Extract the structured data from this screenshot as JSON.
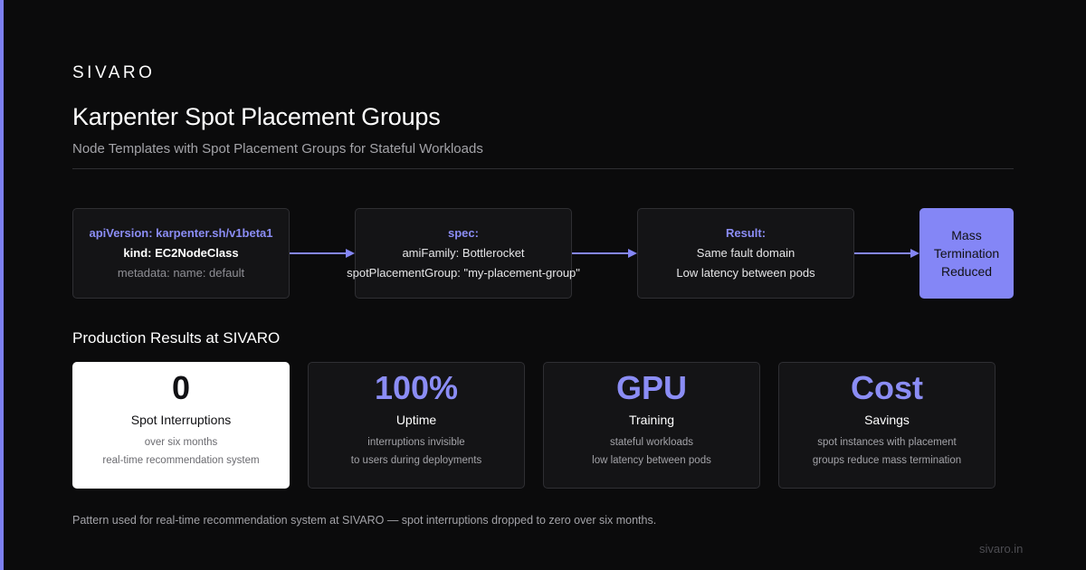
{
  "brand": "SIVARO",
  "title": "Karpenter Spot Placement Groups",
  "subtitle": "Node Templates with Spot Placement Groups for Stateful Workloads",
  "accent_color": "#7c7ff2",
  "flow": {
    "box1": {
      "line1": "apiVersion: karpenter.sh/v1beta1",
      "line2": "kind: EC2NodeClass",
      "line3": "metadata: name: default"
    },
    "box2": {
      "line1": "spec:",
      "line2": "amiFamily: Bottlerocket",
      "line3": "spotPlacementGroup: \"my-placement-group\""
    },
    "box3": {
      "line1": "Result:",
      "line2": "Same fault domain",
      "line3": "Low latency between pods"
    },
    "box4": {
      "text": "Mass Termination Reduced"
    }
  },
  "results_title": "Production Results at SIVARO",
  "stats": [
    {
      "big": "0",
      "label": "Spot Interruptions",
      "desc1": "over six months",
      "desc2": "real-time recommendation system"
    },
    {
      "big": "100%",
      "label": "Uptime",
      "desc1": "interruptions invisible",
      "desc2": "to users during deployments"
    },
    {
      "big": "GPU",
      "label": "Training",
      "desc1": "stateful workloads",
      "desc2": "low latency between pods"
    },
    {
      "big": "Cost",
      "label": "Savings",
      "desc1": "spot instances with placement",
      "desc2": "groups reduce mass termination"
    }
  ],
  "footnote": "Pattern used for real-time recommendation system at SIVARO — spot interruptions dropped to zero over six months.",
  "domain": "sivaro.in"
}
